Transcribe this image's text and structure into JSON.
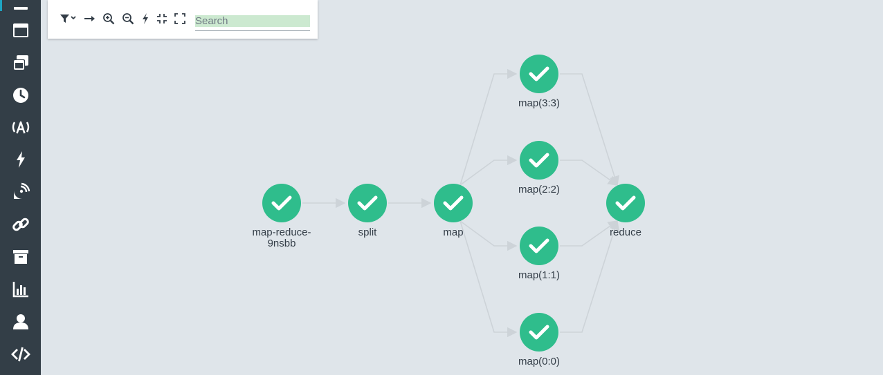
{
  "colors": {
    "sidebar_bg": "#333e47",
    "canvas_bg": "#dfe5ea",
    "node_success": "#2fbd8c",
    "edge": "#cdd3d8",
    "icon": "#ffffff"
  },
  "sidebar": {
    "items": [
      {
        "icon": "menu-icon",
        "active": true
      },
      {
        "icon": "timeline-icon"
      },
      {
        "icon": "workflow-templates-icon"
      },
      {
        "icon": "clock-icon"
      },
      {
        "icon": "event-source-icon"
      },
      {
        "icon": "lightning-icon"
      },
      {
        "icon": "satellite-icon"
      },
      {
        "icon": "link-icon"
      },
      {
        "icon": "archive-icon"
      },
      {
        "icon": "chart-icon"
      },
      {
        "icon": "user-icon"
      },
      {
        "icon": "code-icon"
      }
    ]
  },
  "toolbar": {
    "buttons": [
      {
        "icon": "filter-dropdown-icon"
      },
      {
        "icon": "arrow-right-icon"
      },
      {
        "icon": "zoom-in-icon"
      },
      {
        "icon": "zoom-out-icon"
      },
      {
        "icon": "lightning-icon"
      },
      {
        "icon": "collapse-icon"
      },
      {
        "icon": "expand-icon"
      }
    ],
    "search_placeholder": "Search",
    "search_value": ""
  },
  "graph": {
    "nodes": [
      {
        "id": "root",
        "label_lines": [
          "map-reduce-",
          "9nsbb"
        ],
        "status": "succeeded"
      },
      {
        "id": "split",
        "label_lines": [
          "split"
        ],
        "status": "succeeded"
      },
      {
        "id": "map",
        "label_lines": [
          "map"
        ],
        "status": "succeeded"
      },
      {
        "id": "map33",
        "label_lines": [
          "map(3:3)"
        ],
        "status": "succeeded"
      },
      {
        "id": "map22",
        "label_lines": [
          "map(2:2)"
        ],
        "status": "succeeded"
      },
      {
        "id": "map11",
        "label_lines": [
          "map(1:1)"
        ],
        "status": "succeeded"
      },
      {
        "id": "map00",
        "label_lines": [
          "map(0:0)"
        ],
        "status": "succeeded"
      },
      {
        "id": "reduce",
        "label_lines": [
          "reduce"
        ],
        "status": "succeeded"
      }
    ],
    "edges": [
      {
        "from": "root",
        "to": "split"
      },
      {
        "from": "split",
        "to": "map"
      },
      {
        "from": "map",
        "to": "map33"
      },
      {
        "from": "map",
        "to": "map22"
      },
      {
        "from": "map",
        "to": "map11"
      },
      {
        "from": "map",
        "to": "map00"
      },
      {
        "from": "map33",
        "to": "reduce"
      },
      {
        "from": "map22",
        "to": "reduce"
      },
      {
        "from": "map11",
        "to": "reduce"
      },
      {
        "from": "map00",
        "to": "reduce"
      }
    ]
  }
}
